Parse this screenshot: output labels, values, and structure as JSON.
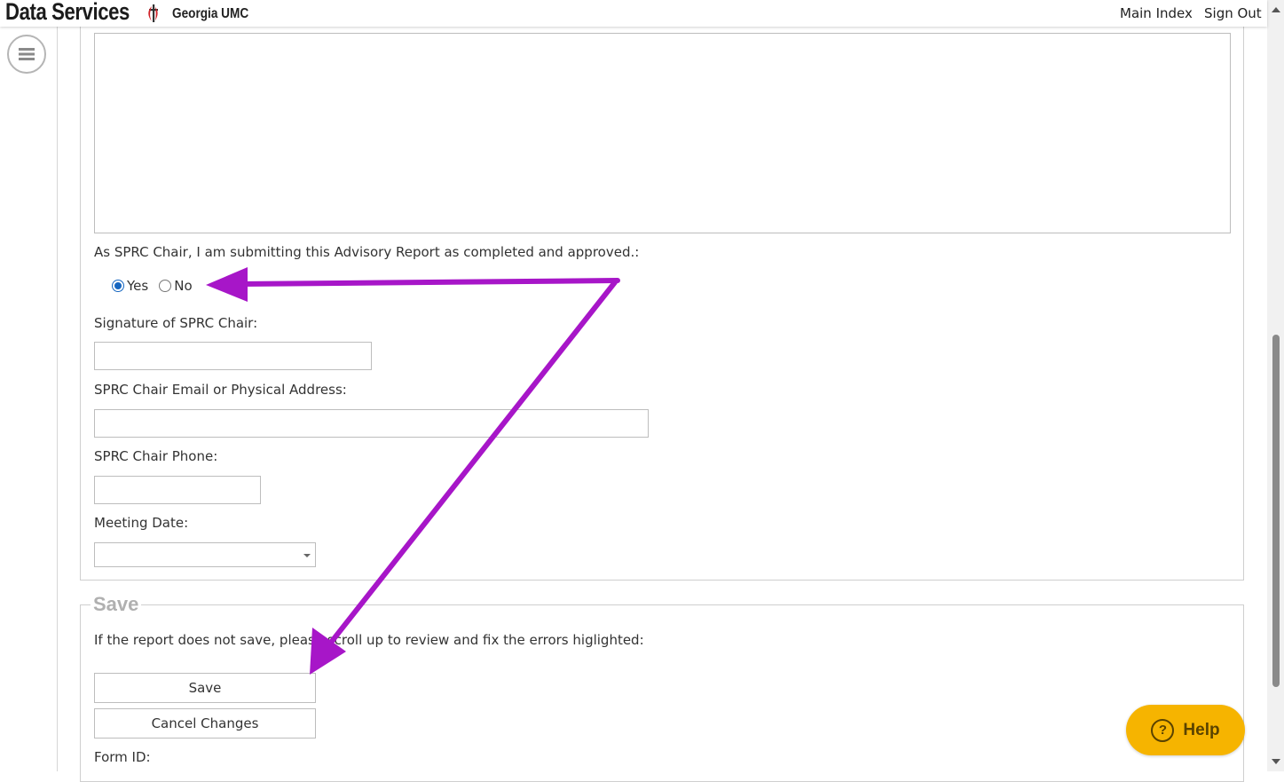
{
  "header": {
    "app_title": "Data Services",
    "org_name": "Georgia UMC",
    "links": [
      "Main Index",
      "Sign Out"
    ]
  },
  "form": {
    "approval_question": "As SPRC Chair, I am submitting this Advisory Report as completed and approved.:",
    "approval_options": [
      {
        "label": "Yes",
        "checked": true
      },
      {
        "label": "No",
        "checked": false
      }
    ],
    "signature_label": "Signature of SPRC Chair:",
    "signature_value": "",
    "email_label": "SPRC Chair Email or Physical Address:",
    "email_value": "",
    "phone_label": "SPRC Chair Phone:",
    "phone_value": "",
    "meeting_date_label": "Meeting Date:",
    "meeting_date_value": ""
  },
  "save_section": {
    "legend": "Save",
    "instructions": "If the report does not save, please scroll up to review and fix the errors higlighted:",
    "save_label": "Save",
    "cancel_label": "Cancel Changes",
    "form_id_label": "Form ID:"
  },
  "help": {
    "label": "Help",
    "icon": "question-icon"
  },
  "colors": {
    "annotation_arrow": "#a716c8",
    "help_button": "#f6b400",
    "radio_selected": "#1565c0"
  }
}
